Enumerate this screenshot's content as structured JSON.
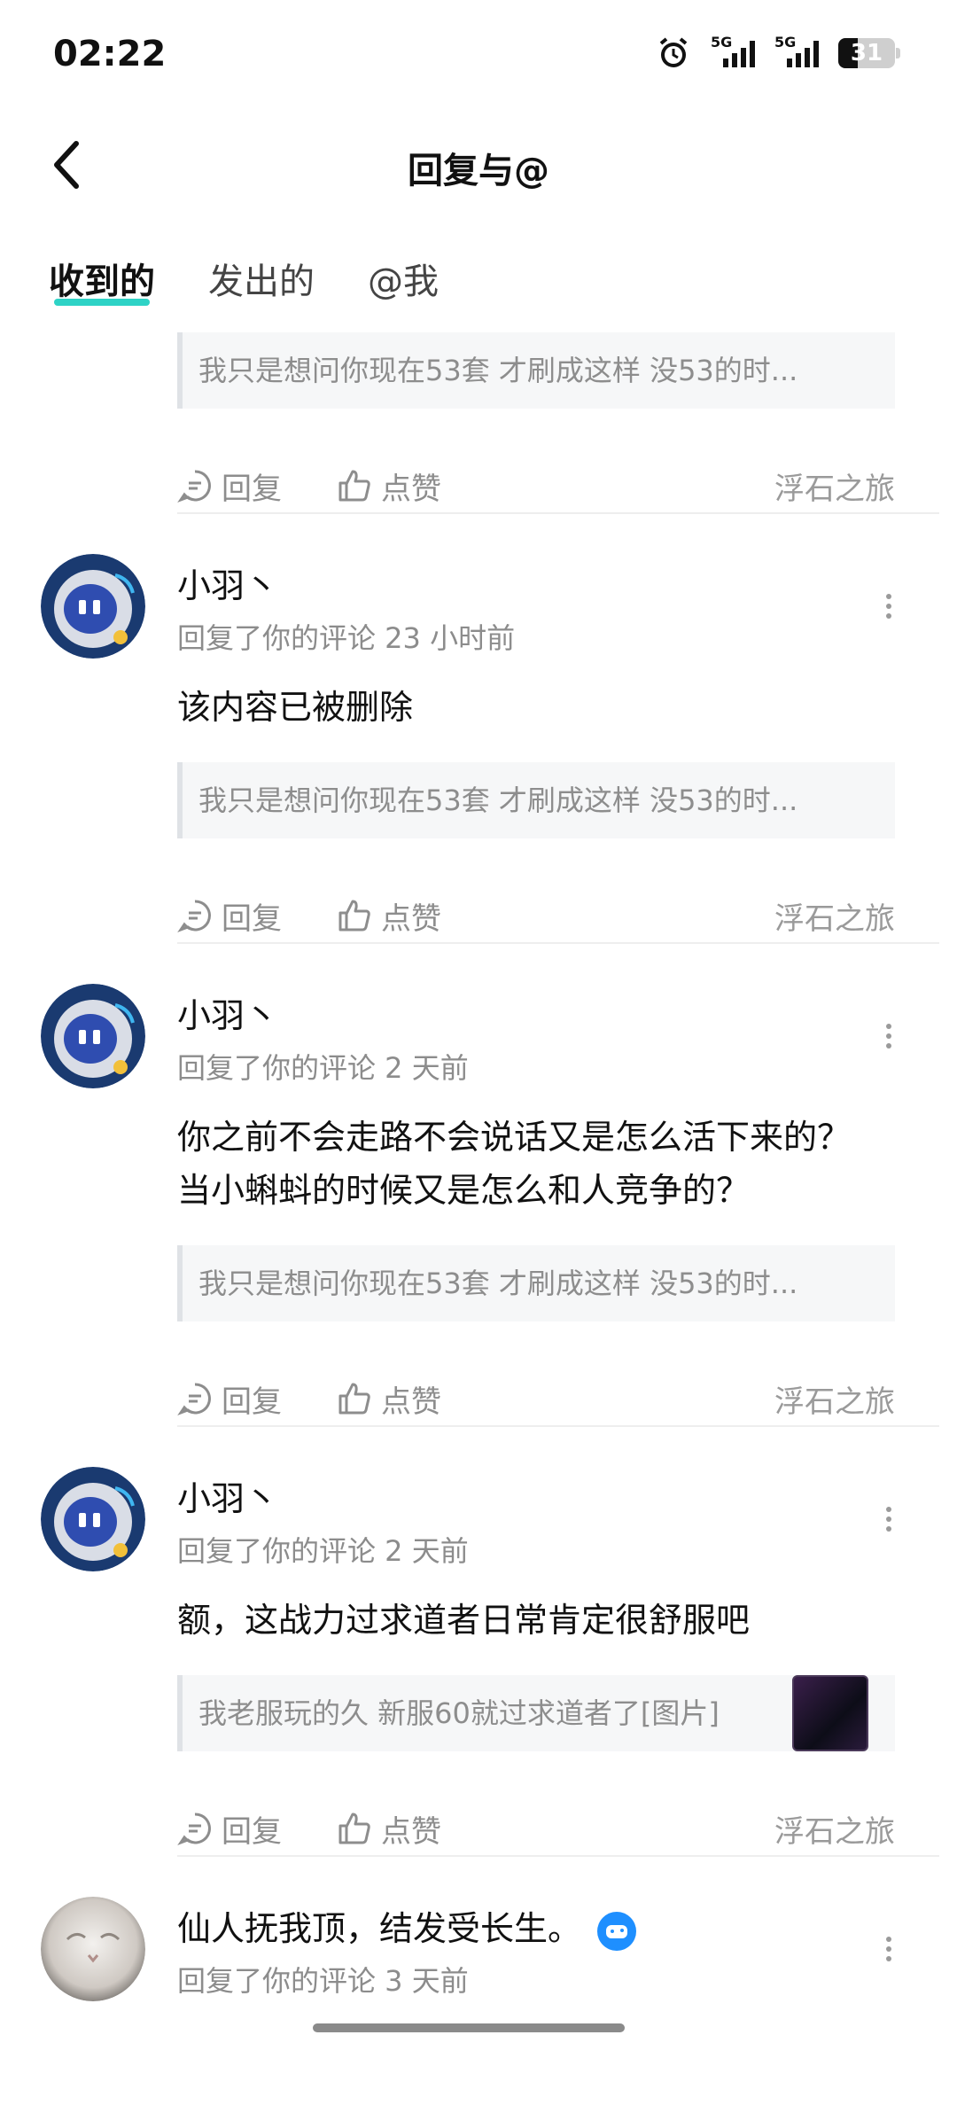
{
  "status_bar": {
    "time": "02:22",
    "signal1_label": "5G",
    "signal2_label": "5G",
    "battery": "31"
  },
  "header": {
    "title": "回复与@"
  },
  "tabs": [
    {
      "label": "收到的",
      "active": true
    },
    {
      "label": "发出的",
      "active": false
    },
    {
      "label": "@我",
      "active": false
    }
  ],
  "actions": {
    "reply_label": "回复",
    "like_label": "点赞"
  },
  "first_partial": {
    "quote": "我只是想问你现在53套  才刷成这样  没53的时...",
    "source": "浮石之旅"
  },
  "items": [
    {
      "name": "小羽丶",
      "meta": "回复了你的评论 23 小时前",
      "content": "该内容已被删除",
      "quote": "我只是想问你现在53套  才刷成这样  没53的时...",
      "source": "浮石之旅"
    },
    {
      "name": "小羽丶",
      "meta": "回复了你的评论 2 天前",
      "content": "你之前不会走路不会说话又是怎么活下来的？当小蝌蚪的时候又是怎么和人竞争的？",
      "quote": "我只是想问你现在53套  才刷成这样  没53的时...",
      "source": "浮石之旅"
    },
    {
      "name": "小羽丶",
      "meta": "回复了你的评论 2 天前",
      "content": "额，这战力过求道者日常肯定很舒服吧",
      "quote": "我老服玩的久 新服60就过求道者了[图片]",
      "source": "浮石之旅"
    },
    {
      "name": "仙人抚我顶，结发受长生。",
      "meta": "回复了你的评论 3 天前"
    }
  ],
  "colors": {
    "accent": "#2ed3c6",
    "muted": "#8d8d8d",
    "badge": "#1e8fff"
  }
}
